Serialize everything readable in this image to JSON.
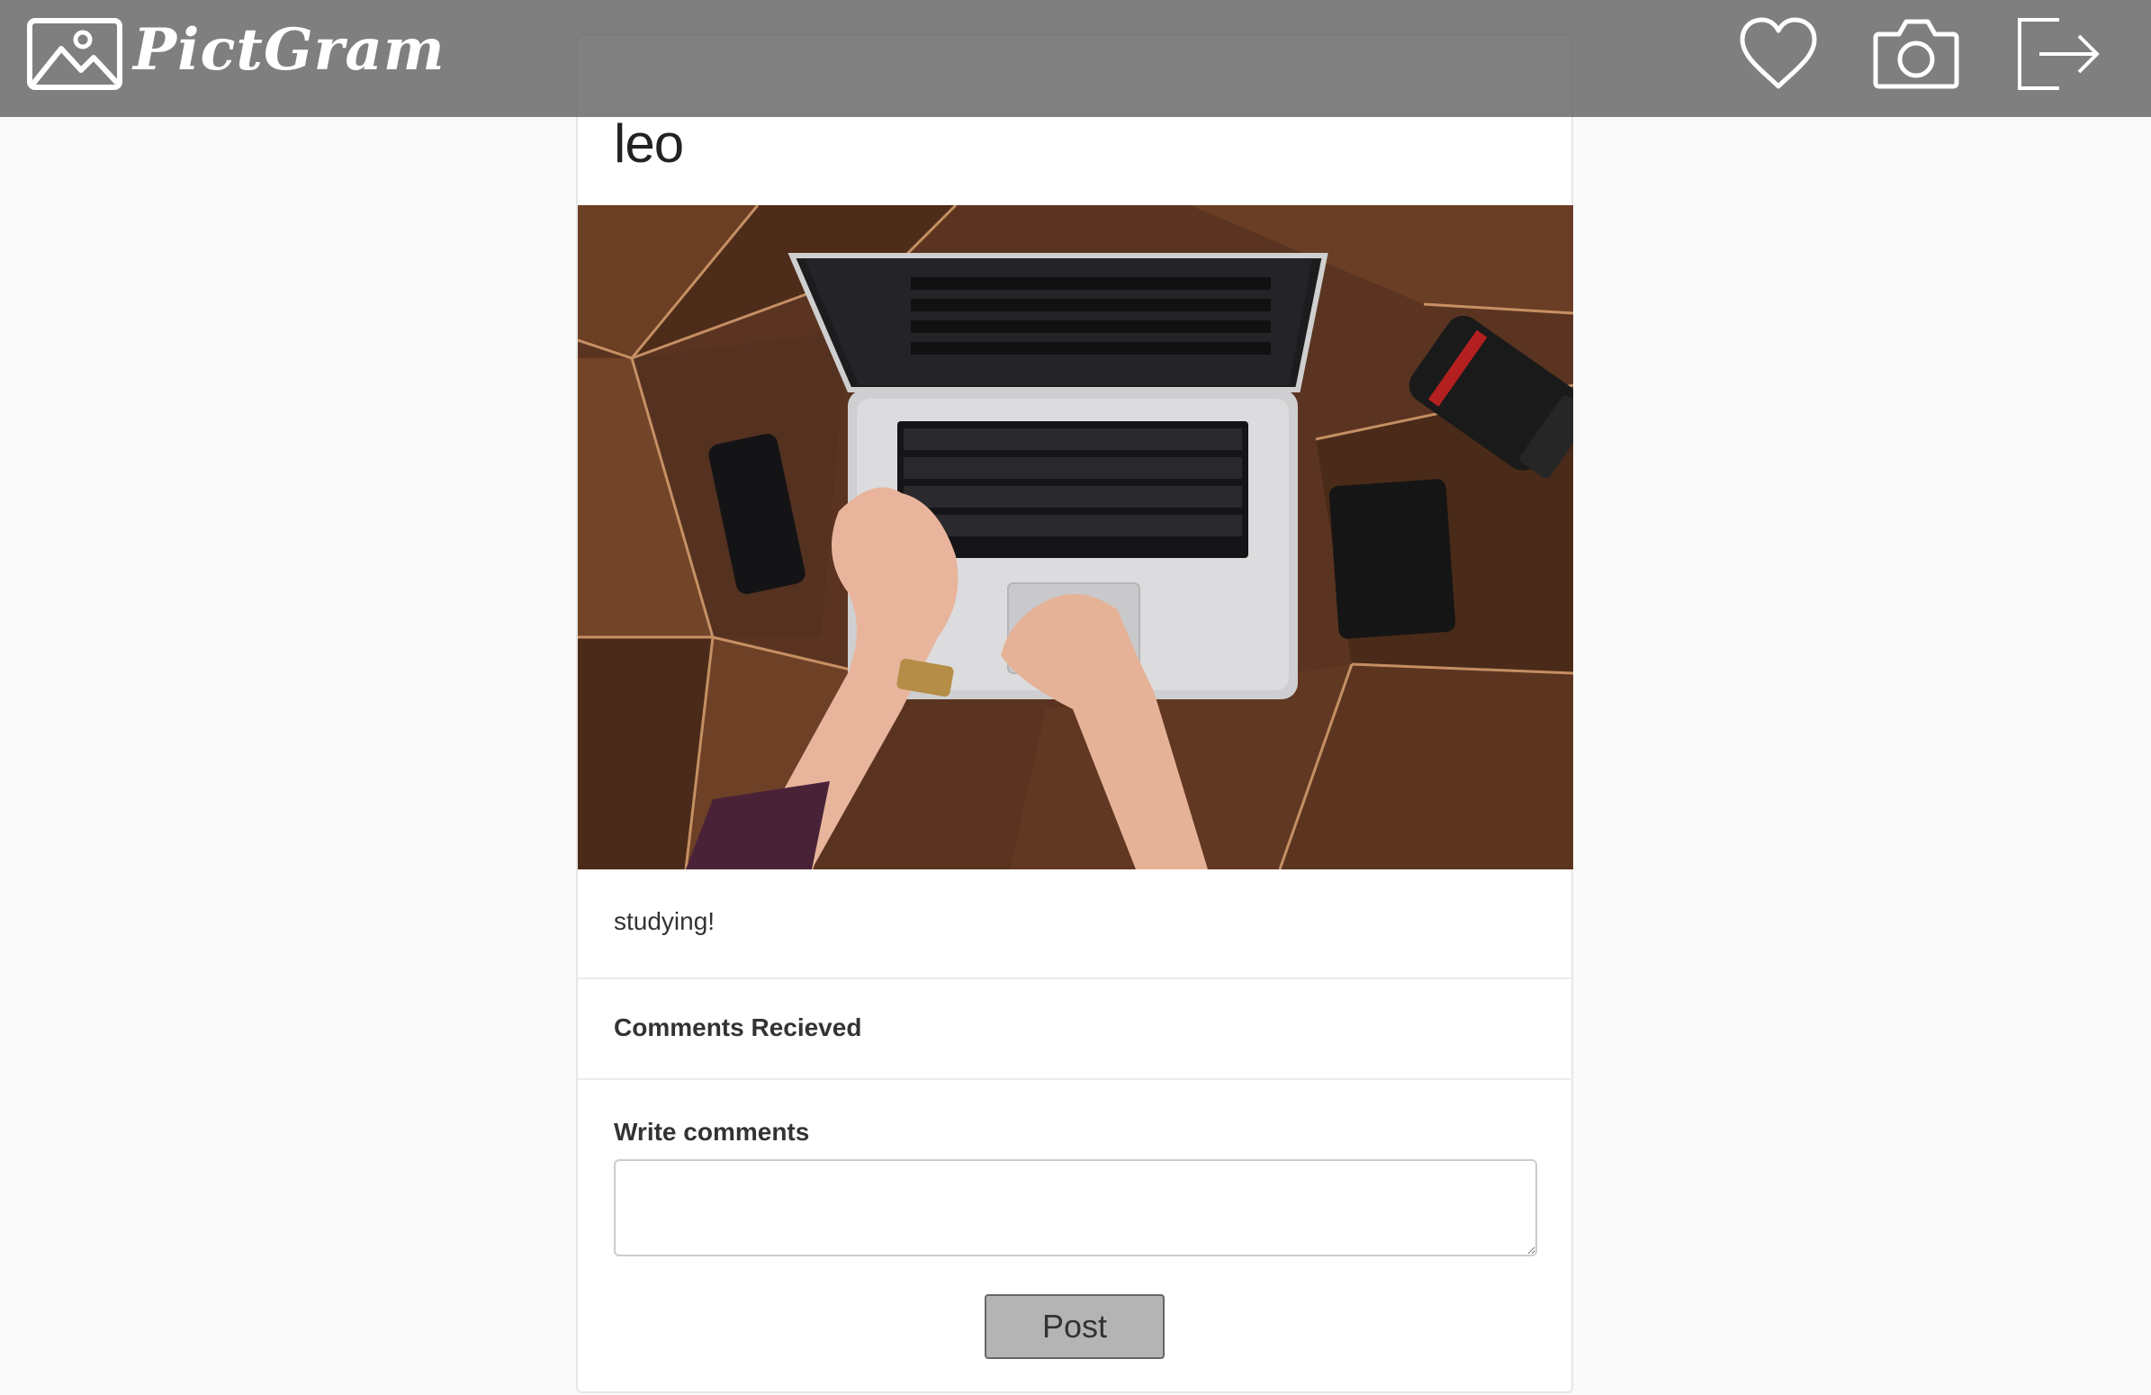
{
  "navbar": {
    "brand": "PictGram",
    "icons": [
      "image-icon",
      "heart-icon",
      "camera-icon",
      "logout-icon"
    ],
    "background": "#646464"
  },
  "post": {
    "username": "leo",
    "caption": "studying!",
    "photo_subject": "laptop on wooden desk"
  },
  "comments": {
    "title": "Comments Recieved"
  },
  "comment_form": {
    "label": "Write comments",
    "value": "",
    "submit_label": "Post"
  }
}
